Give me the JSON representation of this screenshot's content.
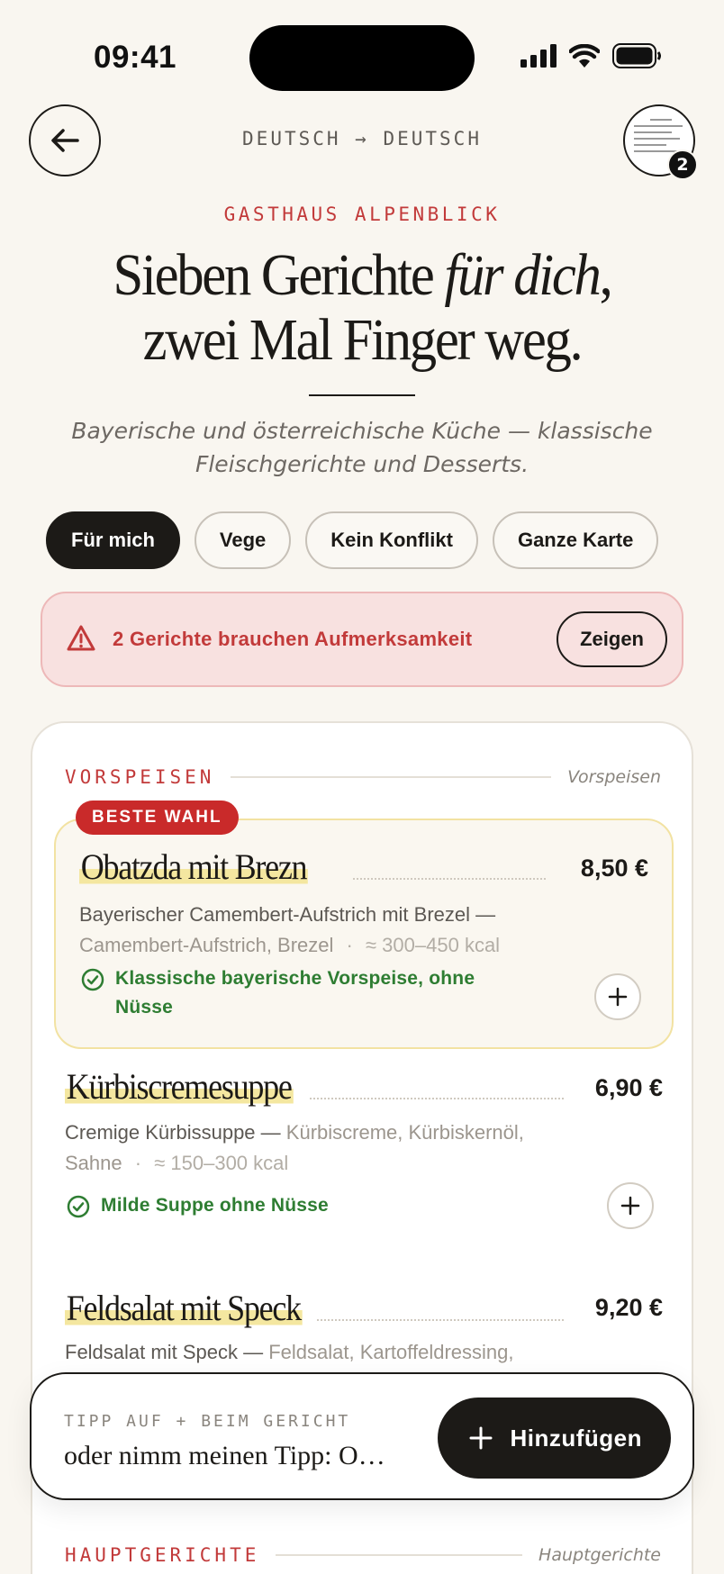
{
  "status_bar": {
    "time": "09:41"
  },
  "nav": {
    "language": "DEUTSCH → DEUTSCH",
    "pages_badge": "2"
  },
  "header": {
    "restaurant": "GASTHAUS ALPENBLICK",
    "headline_line1_plain": "Sieben Gerichte ",
    "headline_line1_italic": "für dich",
    "headline_line1_end": ",",
    "headline_line2": "zwei Mal Finger weg.",
    "subtitle": "Bayerische und österreichische Küche — klassische Fleischgerichte und Desserts."
  },
  "filters": [
    {
      "label": "Für mich",
      "active": true
    },
    {
      "label": "Vege",
      "active": false
    },
    {
      "label": "Kein Konflikt",
      "active": false
    },
    {
      "label": "Ganze Karte",
      "active": false
    }
  ],
  "alert": {
    "text": "2 Gerichte brauchen Aufmerksamkeit",
    "button": "Zeigen"
  },
  "sections": {
    "starters": {
      "title": "VORSPEISEN",
      "subtitle": "Vorspeisen"
    },
    "mains": {
      "title": "HAUPTGERICHTE",
      "subtitle": "Hauptgerichte"
    }
  },
  "dishes": [
    {
      "badge": "BESTE WAHL",
      "name": "Obatzda mit Brezn",
      "price": "8,50 €",
      "description": "Bayerischer Camembert-Aufstrich mit Brezel —",
      "ingredients": "Camembert-Aufstrich, Brezel",
      "separator": "·",
      "kcal": "≈ 300–450 kcal",
      "note": "Klassische bayerische Vorspeise, ohne Nüsse"
    },
    {
      "name": "Kürbiscremesuppe",
      "price": "6,90 €",
      "description": "Cremige Kürbissuppe —",
      "ingredients_line1": "Kürbiscreme, Kürbiskernöl,",
      "ingredients_line2": "Sahne",
      "separator": "·",
      "kcal": "≈ 150–300 kcal",
      "note": "Milde Suppe ohne Nüsse"
    },
    {
      "name": "Feldsalat mit Speck",
      "price": "9,20 €",
      "description": "Feldsalat mit Speck —",
      "ingredients": "Feldsalat, Kartoffeldressing,"
    }
  ],
  "bottom_sheet": {
    "tip_label": "TIPP AUF + BEIM GERICHT",
    "tip_text": "oder nimm meinen Tipp: Oba…",
    "add_button": "Hinzufügen"
  },
  "colors": {
    "background": "#f9f6f0",
    "accent_red": "#c23a3a",
    "success_green": "#2e7d32",
    "highlight_yellow": "#f4e7a0",
    "dark": "#1c1a17"
  },
  "icons": [
    "back-arrow-icon",
    "signal-icon",
    "wifi-icon",
    "battery-icon",
    "warning-icon",
    "check-circle-icon",
    "plus-icon"
  ]
}
